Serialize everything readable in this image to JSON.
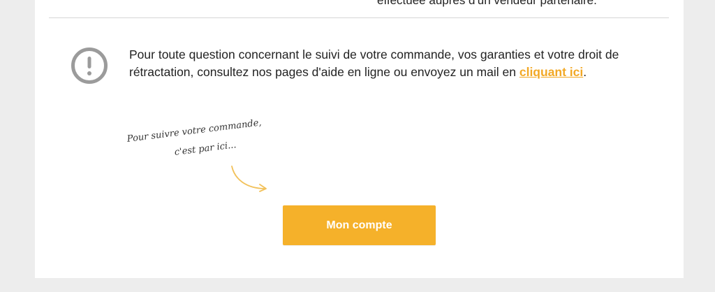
{
  "top_cut_text": "effectuée auprès d'un vendeur partenaire.",
  "info": {
    "text_before_link": "Pour toute question concernant le suivi de votre commande, vos garanties et votre droit de rétractation, consultez nos pages d'aide en ligne ou envoyez un mail en ",
    "link_label": "cliquant ici",
    "text_after_link": ".",
    "icon": "exclamation-circle-icon"
  },
  "handwriting": {
    "line1": "Pour suivre votre commande,",
    "line2": "c'est par ici..."
  },
  "cta": {
    "label": "Mon compte"
  },
  "colors": {
    "accent": "#f5b12a",
    "link": "#f2a825",
    "background": "#ededed",
    "card": "#ffffff"
  }
}
